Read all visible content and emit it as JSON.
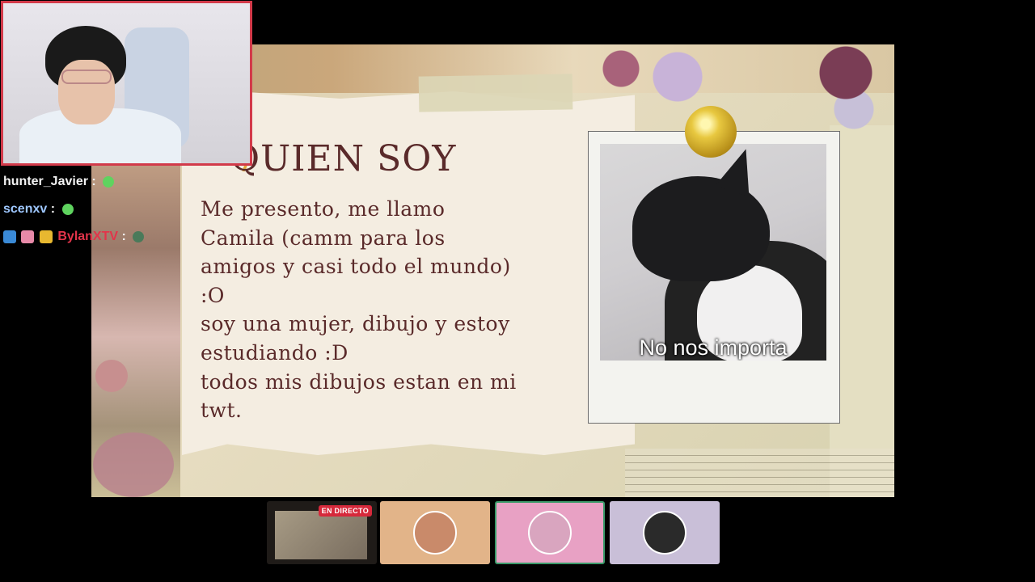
{
  "slide": {
    "title": "QUIEN SOY",
    "body": "Me presento, me llamo\nCamila (camm para los\namigos y casi todo el mundo)\n:O\nsoy una mujer, dibujo y estoy\nestudiando :D\ntodos mis dibujos estan en mi\ntwt.",
    "photo_caption": "No nos importa"
  },
  "chat": {
    "messages": [
      {
        "user": "hunter_Javier",
        "sep": ":",
        "user_color": "#f2f2f2",
        "emote": "emote-green"
      },
      {
        "user": "scenxv",
        "sep": ":",
        "user_color": "#9ec7ff",
        "emote": "emote-green"
      },
      {
        "user": "BylanXTV",
        "sep": ":",
        "user_color": "#e3344a",
        "emote": "emote-frog"
      }
    ]
  },
  "stream_bar": {
    "live_label": "EN DIRECTO",
    "thumbnails": [
      {
        "kind": "live-preview",
        "bg": "#1f1b18"
      },
      {
        "kind": "channel",
        "bg": "#e2b489"
      },
      {
        "kind": "channel",
        "bg": "#e8a1c4"
      },
      {
        "kind": "channel",
        "bg": "#c9bfd8"
      }
    ]
  },
  "colors": {
    "webcam_border": "#d23a4a",
    "title_text": "#5a2a2a",
    "live_badge": "#d6293b"
  }
}
